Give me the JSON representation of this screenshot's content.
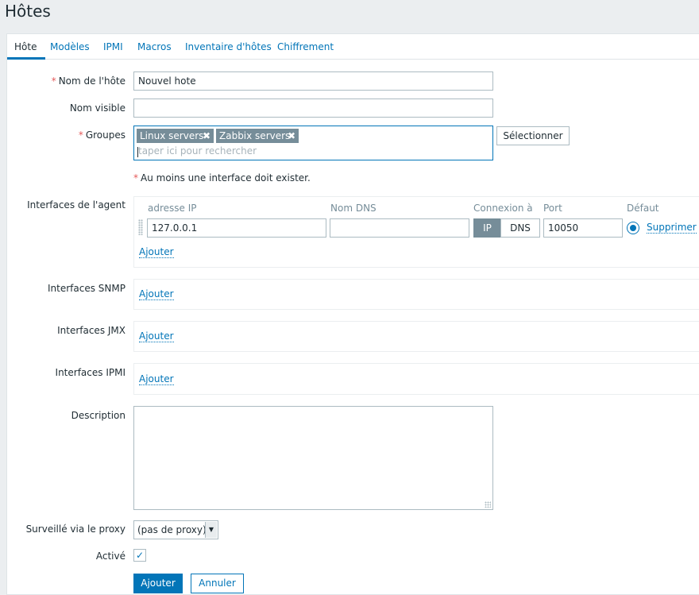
{
  "page_title": "Hôtes",
  "tabs": [
    {
      "label": "Hôte"
    },
    {
      "label": "Modèles"
    },
    {
      "label": "IPMI"
    },
    {
      "label": "Macros"
    },
    {
      "label": "Inventaire d'hôtes"
    },
    {
      "label": "Chiffrement"
    }
  ],
  "form": {
    "required_mark": "*",
    "host_name": {
      "label": "Nom de l'hôte",
      "value": "Nouvel hote"
    },
    "visible_name": {
      "label": "Nom visible",
      "value": ""
    },
    "groups": {
      "label": "Groupes",
      "selected": [
        {
          "name": "Linux servers"
        },
        {
          "name": "Zabbix servers"
        }
      ],
      "remove_icon": "✖",
      "placeholder": "taper ici pour rechercher",
      "select_button": "Sélectionner"
    },
    "interface_warning": "Au moins une interface doit exister.",
    "agent_interfaces": {
      "label": "Interfaces de l'agent",
      "columns": {
        "ip": "adresse IP",
        "dns": "Nom DNS",
        "connect": "Connexion à",
        "port": "Port",
        "default": "Défaut"
      },
      "row": {
        "ip": "127.0.0.1",
        "dns": "",
        "connect_ip": "IP",
        "connect_dns": "DNS",
        "port": "10050",
        "remove": "Supprimer"
      },
      "add": "Ajouter"
    },
    "snmp_interfaces": {
      "label": "Interfaces SNMP",
      "add": "Ajouter"
    },
    "jmx_interfaces": {
      "label": "Interfaces JMX",
      "add": "Ajouter"
    },
    "ipmi_interfaces": {
      "label": "Interfaces IPMI",
      "add": "Ajouter"
    },
    "description": {
      "label": "Description",
      "value": ""
    },
    "proxy": {
      "label": "Surveillé via le proxy",
      "value": "(pas de proxy)"
    },
    "enabled": {
      "label": "Activé",
      "checked": true
    },
    "buttons": {
      "add": "Ajouter",
      "cancel": "Annuler"
    }
  },
  "colors": {
    "accent": "#0275b8",
    "required": "#e45959",
    "chip": "#768d99",
    "background": "#ebeef0"
  }
}
